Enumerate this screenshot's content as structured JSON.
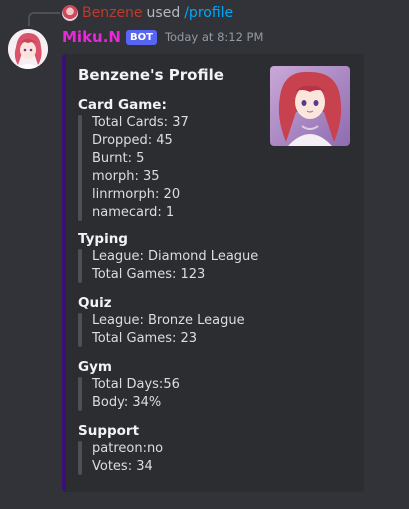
{
  "reply": {
    "user": "Benzene",
    "used": "used",
    "command": "/profile"
  },
  "message": {
    "username": "Miku.N",
    "bot_tag": "BOT",
    "timestamp": "Today at 8:12 PM"
  },
  "embed": {
    "title": "Benzene's Profile",
    "accent_color": "#3b0f7a",
    "sections": {
      "card_game": {
        "name": "Card Game:",
        "lines": [
          "Total Cards: 37",
          "Dropped: 45",
          "Burnt: 5",
          "morph: 35",
          "linrmorph: 20",
          "namecard: 1"
        ]
      },
      "typing": {
        "name": "Typing",
        "lines": [
          "League: Diamond League",
          "Total Games: 123"
        ]
      },
      "quiz": {
        "name": "Quiz",
        "lines": [
          "League: Bronze League",
          "Total Games: 23"
        ]
      },
      "gym": {
        "name": "Gym",
        "lines": [
          "Total Days:56",
          "Body: 34%"
        ]
      },
      "support": {
        "name": "Support",
        "lines": [
          "patreon:no",
          "Votes: 34"
        ]
      }
    }
  }
}
